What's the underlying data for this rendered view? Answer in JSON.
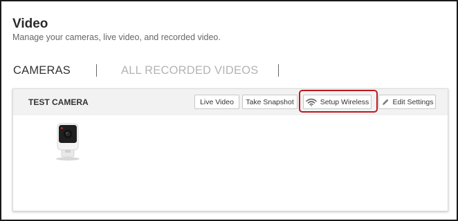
{
  "header": {
    "title": "Video",
    "subtitle": "Manage your cameras, live video, and recorded video."
  },
  "tabs": [
    {
      "label": "CAMERAS",
      "active": true
    },
    {
      "label": "ALL RECORDED VIDEOS",
      "active": false
    }
  ],
  "camera": {
    "name": "TEST CAMERA",
    "buttons": {
      "live_video": "Live Video",
      "take_snapshot": "Take Snapshot",
      "setup_wireless": "Setup Wireless",
      "edit_settings": "Edit Settings"
    },
    "thumbnail_icon": "camera-icon"
  },
  "icons": {
    "setup_wireless": "wifi-icon",
    "edit_settings": "pencil-icon"
  },
  "colors": {
    "highlight": "#c0161c",
    "active_tab": "#333333",
    "inactive_tab": "#b3b3b3",
    "card_header": "#f2f2f2"
  }
}
